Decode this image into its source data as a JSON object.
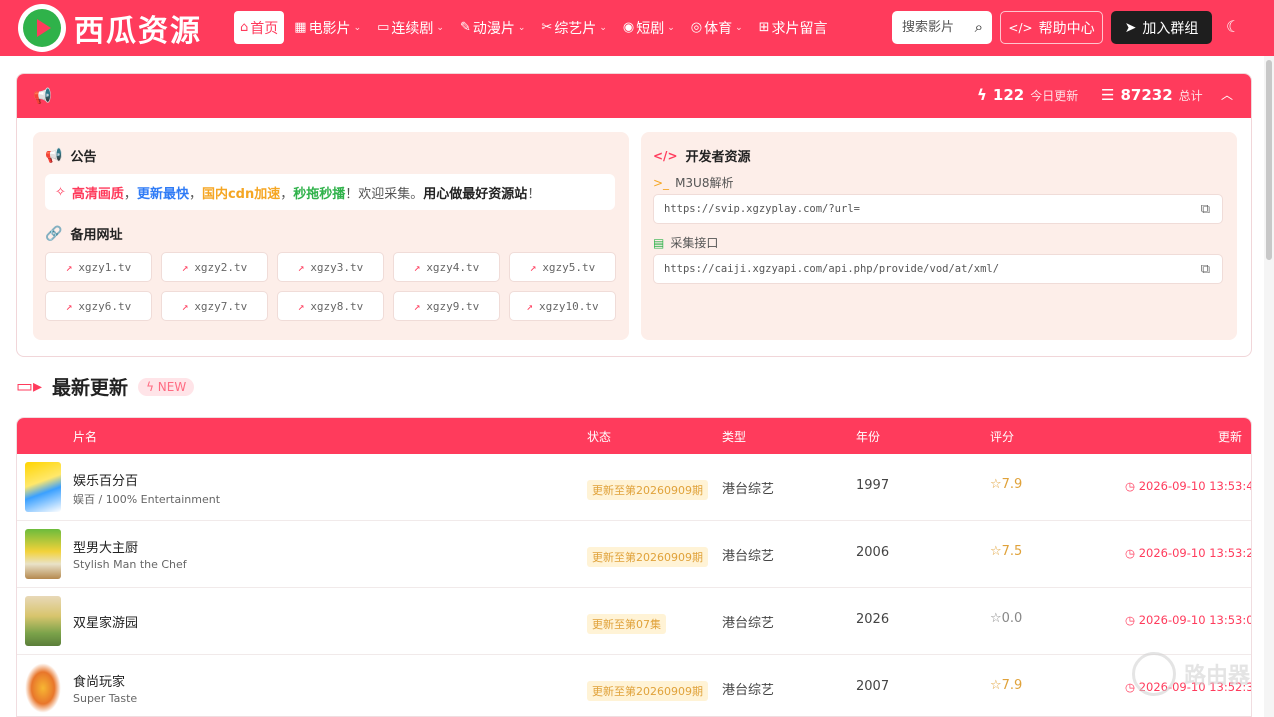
{
  "header": {
    "brand": "西瓜资源",
    "nav": [
      {
        "label": "首页",
        "icon": "⌂",
        "active": true,
        "chevron": false
      },
      {
        "label": "电影片",
        "icon": "▦",
        "active": false,
        "chevron": true
      },
      {
        "label": "连续剧",
        "icon": "▭",
        "active": false,
        "chevron": true
      },
      {
        "label": "动漫片",
        "icon": "✎",
        "active": false,
        "chevron": true
      },
      {
        "label": "综艺片",
        "icon": "✂",
        "active": false,
        "chevron": true
      },
      {
        "label": "短剧",
        "icon": "◉",
        "active": false,
        "chevron": true
      },
      {
        "label": "体育",
        "icon": "◎",
        "active": false,
        "chevron": true
      },
      {
        "label": "求片留言",
        "icon": "⊞",
        "active": false,
        "chevron": false
      }
    ],
    "search_placeholder": "搜索影片",
    "help_label": "帮助中心",
    "join_label": "加入群组"
  },
  "stats": {
    "today_count": "122",
    "today_label": "今日更新",
    "total_count": "87232",
    "total_label": "总计"
  },
  "notice": {
    "title": "公告",
    "parts": {
      "p1": "高清画质",
      "s1": "，",
      "p2": "更新最快",
      "s2": "，",
      "p3": "国内cdn加速",
      "s3": "，",
      "p4": "秒拖秒播",
      "p5": "！欢迎采集。",
      "p6": "用心做最好资源站",
      "p7": "！"
    }
  },
  "mirrors": {
    "title": "备用网址",
    "items": [
      "xgzy1.tv",
      "xgzy2.tv",
      "xgzy3.tv",
      "xgzy4.tv",
      "xgzy5.tv",
      "xgzy6.tv",
      "xgzy7.tv",
      "xgzy8.tv",
      "xgzy9.tv",
      "xgzy10.tv"
    ]
  },
  "developer": {
    "title": "开发者资源",
    "m3u8_label": "M3U8解析",
    "m3u8_url": "https://svip.xgzyplay.com/?url=",
    "api_label": "采集接口",
    "api_url": "https://caiji.xgzyapi.com/api.php/provide/vod/at/xml/"
  },
  "latest": {
    "title": "最新更新",
    "badge": "NEW",
    "columns": {
      "name": "片名",
      "status": "状态",
      "type": "类型",
      "year": "年份",
      "rating": "评分",
      "updated": "更新"
    },
    "rows": [
      {
        "title": "娱乐百分百",
        "subtitle": "娱百 / 100% Entertainment",
        "status": "更新至第20260909期",
        "type": "港台综艺",
        "year": "1997",
        "rating": "7.9",
        "updated": "2026-09-10 13:53:4"
      },
      {
        "title": "型男大主厨",
        "subtitle": "Stylish Man the Chef",
        "status": "更新至第20260909期",
        "type": "港台综艺",
        "year": "2006",
        "rating": "7.5",
        "updated": "2026-09-10 13:53:2"
      },
      {
        "title": "双星家游园",
        "subtitle": "",
        "status": "更新至第07集",
        "type": "港台综艺",
        "year": "2026",
        "rating": "0.0",
        "updated": "2026-09-10 13:53:0"
      },
      {
        "title": "食尚玩家",
        "subtitle": "Super Taste",
        "status": "更新至第20260909期",
        "type": "港台综艺",
        "year": "2007",
        "rating": "7.9",
        "updated": "2026-09-10 13:52:3"
      }
    ]
  },
  "watermark": "路由器"
}
